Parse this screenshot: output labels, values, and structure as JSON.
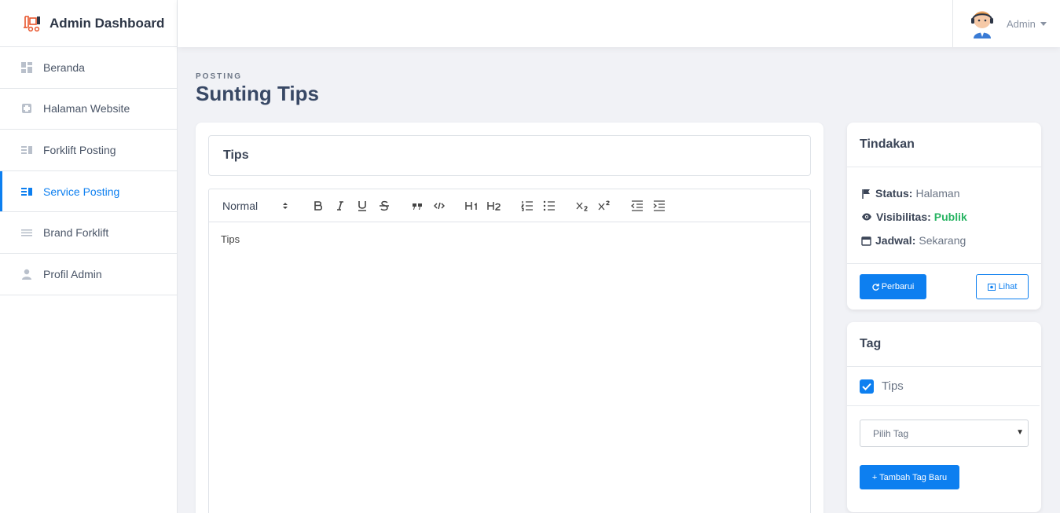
{
  "brand": {
    "title": "Admin Dashboard"
  },
  "sidebar": {
    "items": [
      {
        "label": "Beranda",
        "icon": "dashboard-icon"
      },
      {
        "label": "Halaman Website",
        "icon": "puzzle-icon"
      },
      {
        "label": "Forklift Posting",
        "icon": "list-icon"
      },
      {
        "label": "Service Posting",
        "icon": "list-icon",
        "active": true
      },
      {
        "label": "Brand Forklift",
        "icon": "lines-icon"
      },
      {
        "label": "Profil Admin",
        "icon": "user-icon"
      }
    ]
  },
  "topbar": {
    "user_name": "Admin"
  },
  "page": {
    "eyebrow": "POSTING",
    "title": "Sunting Tips"
  },
  "editor": {
    "title_value": "Tips",
    "format_select": "Normal",
    "content": "Tips",
    "toolbar_icons": [
      "bold-icon",
      "italic-icon",
      "underline-icon",
      "strike-icon",
      "blockquote-icon",
      "code-icon",
      "h1-icon",
      "h2-icon",
      "ordered-list-icon",
      "bullet-list-icon",
      "subscript-icon",
      "superscript-icon",
      "outdent-icon",
      "indent-icon"
    ]
  },
  "actions": {
    "heading": "Tindakan",
    "status_label": "Status:",
    "status_value": "Halaman",
    "visibility_label": "Visibilitas:",
    "visibility_value": "Publik",
    "schedule_label": "Jadwal:",
    "schedule_value": "Sekarang",
    "update_button": "Perbarui",
    "view_button": "Lihat"
  },
  "tags": {
    "heading": "Tag",
    "checked_tag": "Tips",
    "select_placeholder": "Pilih Tag",
    "add_button": "+ Tambah Tag Baru"
  },
  "colors": {
    "primary": "#0d7ff0",
    "success": "#28b463",
    "background": "#f1f2f6"
  }
}
